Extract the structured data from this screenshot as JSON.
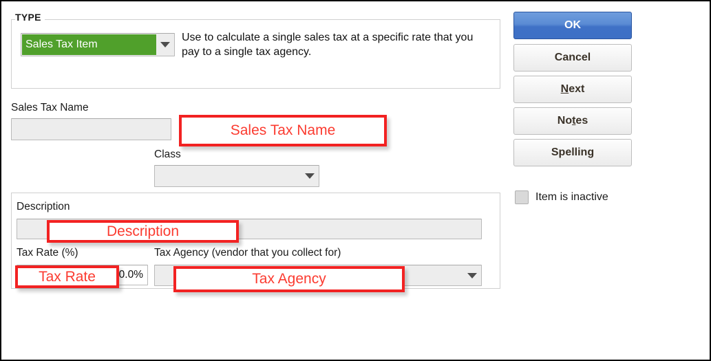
{
  "dialog": {
    "type_group": {
      "legend": "TYPE",
      "selected_type": "Sales Tax Item",
      "help_text": "Use to calculate a single sales tax at a specific rate that you pay to a single tax agency."
    },
    "sales_tax_name": {
      "label": "Sales Tax Name",
      "value": "",
      "placeholder": ""
    },
    "class": {
      "label": "Class",
      "value": "",
      "placeholder": ""
    },
    "description_group": {
      "description_label": "Description",
      "description_value": "",
      "tax_rate_label": "Tax Rate (%)",
      "tax_rate_value": "0.0%",
      "tax_agency_label": "Tax Agency (vendor that you collect for)",
      "tax_agency_value": ""
    },
    "buttons": [
      {
        "label": "OK",
        "accel": "",
        "primary": true
      },
      {
        "label": "Cancel",
        "accel": "",
        "primary": false
      },
      {
        "label": "Next",
        "accel": "N",
        "primary": false
      },
      {
        "label": "Notes",
        "accel": "t",
        "primary": false
      },
      {
        "label": "Spelling",
        "accel": "g",
        "primary": false
      }
    ],
    "inactive_checkbox": {
      "label": "Item is inactive",
      "checked": false
    }
  },
  "annotations": [
    {
      "id": "sales-tax-name",
      "text": "Sales Tax Name"
    },
    {
      "id": "description",
      "text": "Description"
    },
    {
      "id": "tax-rate",
      "text": "Tax Rate"
    },
    {
      "id": "tax-agency",
      "text": "Tax Agency"
    }
  ],
  "colors": {
    "annotation_red": "#f22222",
    "annotation_text_red": "#fb3b30",
    "selection_green": "#50a02b",
    "primary_button_blue": "#3f71c6",
    "field_gray": "#ededed"
  }
}
